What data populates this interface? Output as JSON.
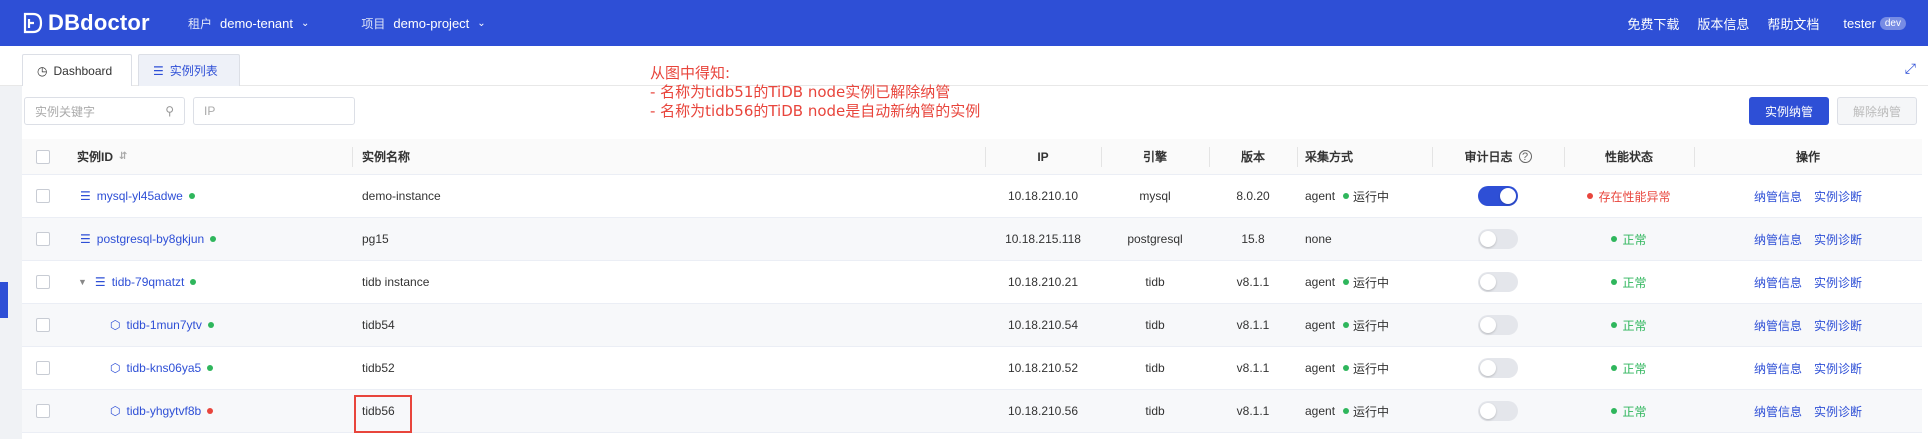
{
  "header": {
    "brand": "DBdoctor",
    "tenant_label": "租户",
    "tenant_value": "demo-tenant",
    "project_label": "项目",
    "project_value": "demo-project",
    "links": [
      "免费下载",
      "版本信息",
      "帮助文档"
    ],
    "user": "tester",
    "user_badge": "dev"
  },
  "tabs": [
    {
      "label": "Dashboard",
      "icon": "dashboard-icon",
      "active": true
    },
    {
      "label": "实例列表",
      "icon": "list-icon",
      "active": false
    }
  ],
  "toolbar": {
    "keyword_placeholder": "实例关键字",
    "ip_placeholder": "IP",
    "primary_button": "实例纳管",
    "secondary_button": "解除纳管"
  },
  "annotation": {
    "line1": "从图中得知:",
    "line2": "- 名称为tidb51的TiDB node实例已解除纳管",
    "line3": "- 名称为tidb56的TiDB node是自动新纳管的实例"
  },
  "table": {
    "columns": [
      "实例ID",
      "实例名称",
      "IP",
      "引擎",
      "版本",
      "采集方式",
      "审计日志",
      "性能状态",
      "操作"
    ],
    "rows": [
      {
        "id": "mysql-yl45adwe",
        "id_status": "green",
        "name": "demo-instance",
        "ip": "10.18.210.10",
        "engine": "mysql",
        "version": "8.0.20",
        "collect": "agent",
        "collect_status": "运行中",
        "audit_on": true,
        "perf": "存在性能异常",
        "perf_ok": false,
        "level": 0,
        "expandable": false,
        "icon": "layers-icon"
      },
      {
        "id": "postgresql-by8gkjun",
        "id_status": "green",
        "name": "pg15",
        "ip": "10.18.215.118",
        "engine": "postgresql",
        "version": "15.8",
        "collect": "none",
        "collect_status": "",
        "audit_on": false,
        "perf": "正常",
        "perf_ok": true,
        "level": 0,
        "expandable": false,
        "icon": "layers-icon"
      },
      {
        "id": "tidb-79qmatzt",
        "id_status": "green",
        "name": "tidb instance",
        "ip": "10.18.210.21",
        "engine": "tidb",
        "version": "v8.1.1",
        "collect": "agent",
        "collect_status": "运行中",
        "audit_on": false,
        "perf": "正常",
        "perf_ok": true,
        "level": 0,
        "expandable": true,
        "icon": "layers-icon"
      },
      {
        "id": "tidb-1mun7ytv",
        "id_status": "green",
        "name": "tidb54",
        "ip": "10.18.210.54",
        "engine": "tidb",
        "version": "v8.1.1",
        "collect": "agent",
        "collect_status": "运行中",
        "audit_on": false,
        "perf": "正常",
        "perf_ok": true,
        "level": 1,
        "expandable": false,
        "icon": "cube-icon"
      },
      {
        "id": "tidb-kns06ya5",
        "id_status": "green",
        "name": "tidb52",
        "ip": "10.18.210.52",
        "engine": "tidb",
        "version": "v8.1.1",
        "collect": "agent",
        "collect_status": "运行中",
        "audit_on": false,
        "perf": "正常",
        "perf_ok": true,
        "level": 1,
        "expandable": false,
        "icon": "cube-icon"
      },
      {
        "id": "tidb-yhgytvf8b",
        "id_status": "red",
        "name": "tidb56",
        "ip": "10.18.210.56",
        "engine": "tidb",
        "version": "v8.1.1",
        "collect": "agent",
        "collect_status": "运行中",
        "audit_on": false,
        "perf": "正常",
        "perf_ok": true,
        "level": 1,
        "expandable": false,
        "icon": "cube-icon"
      }
    ],
    "op_labels": [
      "纳管信息",
      "实例诊断"
    ]
  },
  "colors": {
    "brand": "#2e4fd6",
    "ok": "#2fb65c",
    "error": "#e8453c"
  }
}
